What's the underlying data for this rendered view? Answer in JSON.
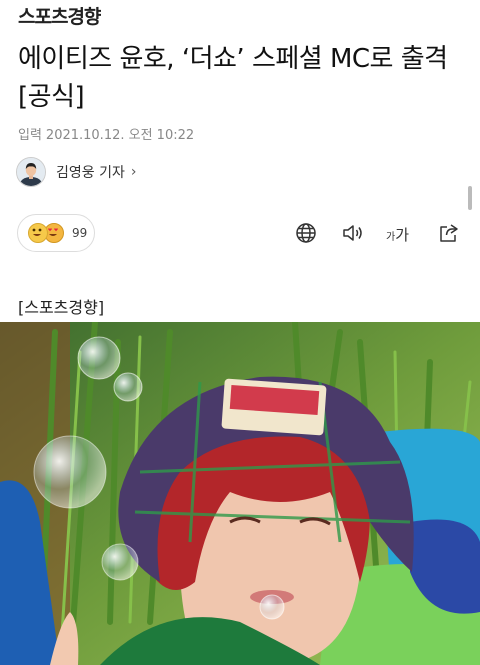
{
  "header": {
    "logo": "스포츠경향"
  },
  "article": {
    "title": "에이티즈 윤호, ‘더쇼’ 스페셜 MC로 출격 [공식]",
    "date_label": "입력",
    "date": "2021.10.12. 오전 10:22",
    "reporter": "김영웅 기자",
    "source_tag": "[스포츠경향]"
  },
  "reactions": {
    "count": "99",
    "icons": [
      "grinning-face",
      "heart-eyes-face"
    ]
  },
  "toolbar": {
    "icons": [
      "globe-icon",
      "speaker-icon",
      "font-size-icon",
      "share-icon"
    ],
    "font_small": "가",
    "font_large": "가"
  },
  "colors": {
    "text": "#111111",
    "muted": "#888888",
    "accent_red": "#b3262a"
  }
}
